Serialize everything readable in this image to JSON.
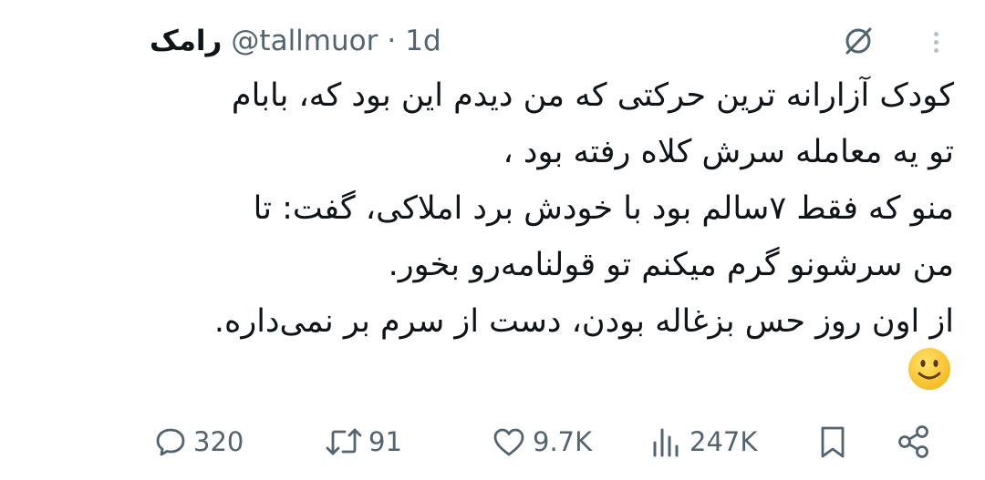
{
  "tweet": {
    "author_name": "رامک",
    "handle": "@tallmuor",
    "separator": "·",
    "time": "1d",
    "lines": [
      "کودک آزارانه ترین حرکتی که من دیدم این بود که، بابام",
      "تو یه معامله سرش کلاه رفته بود ،",
      "منو که فقط ۷سالم بود با خودش برد املاکی، گفت: تا",
      "من سرشونو گرم میکنم تو قولنامه‌رو بخور.",
      "از اون روز حس بزغاله بودن، دست از سرم بر نمی‌داره."
    ],
    "emoji": "slightly-smiling-face"
  },
  "actions": {
    "replies": "320",
    "reposts": "91",
    "likes": "9.7K",
    "views": "247K"
  },
  "icons": {
    "grok": "grok-icon",
    "more": "more-dots-icon",
    "reply": "reply-icon",
    "repost": "repost-icon",
    "like": "heart-icon",
    "views": "views-icon",
    "bookmark": "bookmark-icon",
    "share": "share-icon"
  },
  "colors": {
    "text": "#0f1419",
    "secondary": "#536471",
    "background": "#ffffff",
    "emoji": "#ffcc33"
  }
}
